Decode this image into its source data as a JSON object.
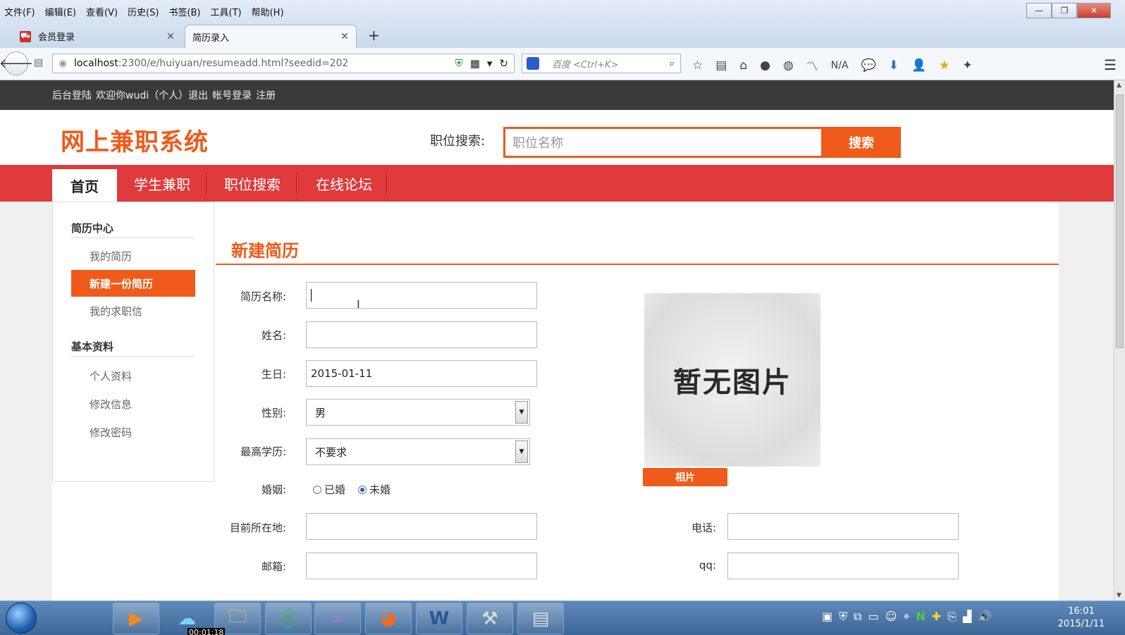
{
  "browser": {
    "menu": [
      "文件(F)",
      "编辑(E)",
      "查看(V)",
      "历史(S)",
      "书签(B)",
      "工具(T)",
      "帮助(H)"
    ],
    "window_controls": {
      "minimize": "—",
      "restore": "❐",
      "close": "✕"
    },
    "tabs": [
      {
        "label": "会员登录",
        "active": false
      },
      {
        "label": "简历录入",
        "active": true
      }
    ],
    "new_tab": "+",
    "url": {
      "host": "localhost",
      "path": ":2300/e/huiyuan/resumeadd.html?seedid=202"
    },
    "search_placeholder": "百度 <Ctrl+K>",
    "na_label": "N/A"
  },
  "site": {
    "topbar": [
      "后台登陆",
      "欢迎你wudi（个人）退出",
      "帐号登录",
      "注册"
    ],
    "logo": "网上兼职系统",
    "search_label": "职位搜索:",
    "search_placeholder": "职位名称",
    "search_button": "搜索",
    "nav": [
      "首页",
      "学生兼职",
      "职位搜索",
      "在线论坛"
    ]
  },
  "sidebar": {
    "group1_title": "简历中心",
    "group1_items": [
      "我的简历",
      "新建一份简历",
      "我的求职信"
    ],
    "group2_title": "基本资料",
    "group2_items": [
      "个人资料",
      "修改信息",
      "修改密码"
    ]
  },
  "form": {
    "title": "新建简历",
    "resume_name_label": "简历名称:",
    "resume_name_value": "",
    "name_label": "姓名:",
    "name_value": "",
    "birthday_label": "生日:",
    "birthday_value": "2015-01-11",
    "gender_label": "性别:",
    "gender_value": "男",
    "education_label": "最高学历:",
    "education_value": "不要求",
    "marriage_label": "婚姻:",
    "marriage_options": [
      "已婚",
      "未婚"
    ],
    "marriage_selected": "未婚",
    "location_label": "目前所在地:",
    "email_label": "邮箱:",
    "phone_label": "电话:",
    "qq_label": "qq:",
    "photo_placeholder": "暂无图片",
    "photo_button": "相片"
  },
  "taskbar": {
    "time": "16:01",
    "date": "2015/1/11",
    "timestamp": "00:01:18"
  },
  "colors": {
    "accent": "#f05a1a",
    "nav_red": "#e03a3c",
    "topbar": "#3a3a3a"
  }
}
